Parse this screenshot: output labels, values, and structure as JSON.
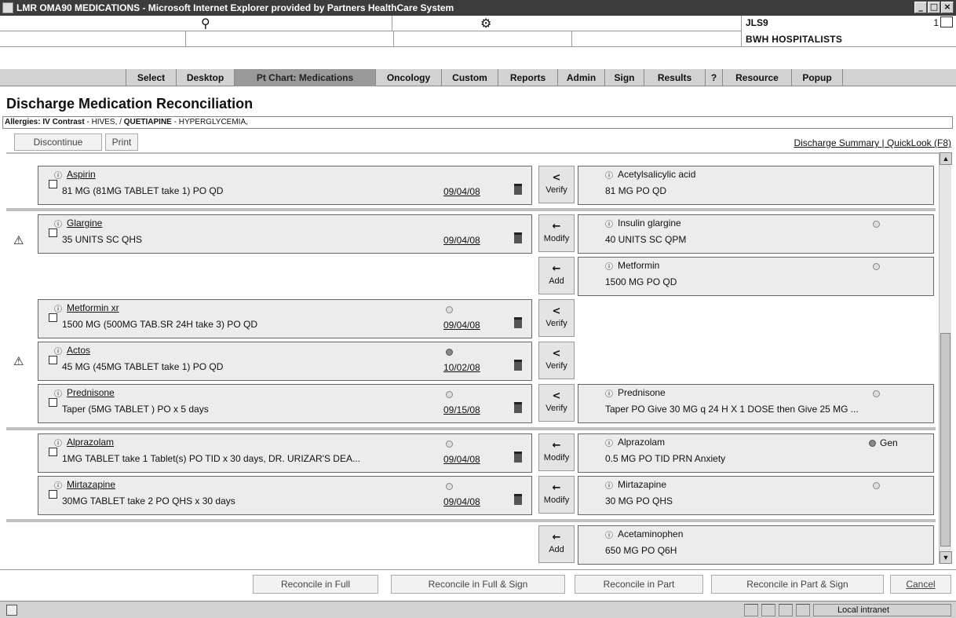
{
  "window": {
    "title": "LMR OMA90 MEDICATIONS - Microsoft Internet Explorer provided by Partners HealthCare System",
    "buttons": [
      "_",
      "□",
      "×"
    ]
  },
  "header": {
    "user_code": "JLS9",
    "count": "1",
    "group": "BWH HOSPITALISTS",
    "search_glyph": "⚲",
    "settings_glyph": "⚙"
  },
  "menu": [
    "Select",
    "Desktop",
    "Pt Chart: Medications",
    "Oncology",
    "Custom",
    "Reports",
    "Admin",
    "Sign",
    "Results",
    "?",
    "Resource",
    "Popup"
  ],
  "page": {
    "title": "Discharge Medication Reconciliation",
    "allergies_label": "Allergies:",
    "allergy1_name": "IV Contrast",
    "allergy1_reaction": " - HIVES, / ",
    "allergy2_name": "QUETIAPINE",
    "allergy2_reaction": " - HYPERGLYCEMIA,"
  },
  "toolbar": {
    "discontinue": "Discontinue",
    "print": "Print",
    "discharge_summary": "Discharge Summary",
    "separator": " | ",
    "quicklook": "QuickLook (F8)"
  },
  "icons": {
    "info": "ⓘ",
    "warning": "⚠",
    "arrow_verify": "<",
    "arrow_move": "←"
  },
  "rows": [
    {
      "left": {
        "name": "Aspirin",
        "sig": "81 MG (81MG TABLET take 1) PO QD",
        "date": "09/04/08"
      },
      "action": "Verify",
      "right": {
        "name": "Acetylsalicylic acid",
        "sig": "81 MG PO QD"
      }
    },
    {
      "left": {
        "name": "Glargine",
        "sig": "35 UNITS SC QHS",
        "date": "09/04/08"
      },
      "action": "Modify",
      "right": {
        "name": "Insulin glargine",
        "sig": "40 UNITS SC QPM"
      }
    },
    {
      "action": "Add",
      "right": {
        "name": "Metformin",
        "sig": "1500 MG PO QD"
      }
    },
    {
      "left": {
        "name": "Metformin xr",
        "sig": "1500 MG (500MG TAB.SR 24H take 3) PO QD",
        "date": "09/04/08"
      },
      "action": "Verify"
    },
    {
      "left": {
        "name": "Actos",
        "sig": "45 MG (45MG TABLET take 1) PO QD",
        "date": "10/02/08"
      },
      "action": "Verify"
    },
    {
      "left": {
        "name": "Prednisone",
        "sig": "Taper (5MG TABLET ) PO x 5 days",
        "date": "09/15/08"
      },
      "action": "Verify",
      "right": {
        "name": "Prednisone",
        "sig": "Taper PO Give 30 MG q 24 H X 1 DOSE then Give 25 MG ..."
      }
    },
    {
      "left": {
        "name": "Alprazolam",
        "sig": "1MG TABLET take 1 Tablet(s) PO TID x 30 days, DR. URIZAR'S DEA...",
        "date": "09/04/08"
      },
      "action": "Modify",
      "right": {
        "name": "Alprazolam",
        "sig": "0.5 MG PO TID PRN Anxiety",
        "gen": "Gen"
      }
    },
    {
      "left": {
        "name": "Mirtazapine",
        "sig": "30MG TABLET take 2 PO QHS x 30 days",
        "date": "09/04/08"
      },
      "action": "Modify",
      "right": {
        "name": "Mirtazapine",
        "sig": "30 MG PO QHS"
      }
    },
    {
      "action": "Add",
      "right": {
        "name": "Acetaminophen",
        "sig": "650 MG PO Q6H"
      }
    }
  ],
  "bottom_buttons": {
    "reconcile_full": "Reconcile in Full",
    "reconcile_full_sign": "Reconcile in Full & Sign",
    "reconcile_part": "Reconcile in Part",
    "reconcile_part_sign": "Reconcile in Part & Sign",
    "cancel": "Cancel"
  },
  "status": {
    "zone": "Local intranet"
  }
}
